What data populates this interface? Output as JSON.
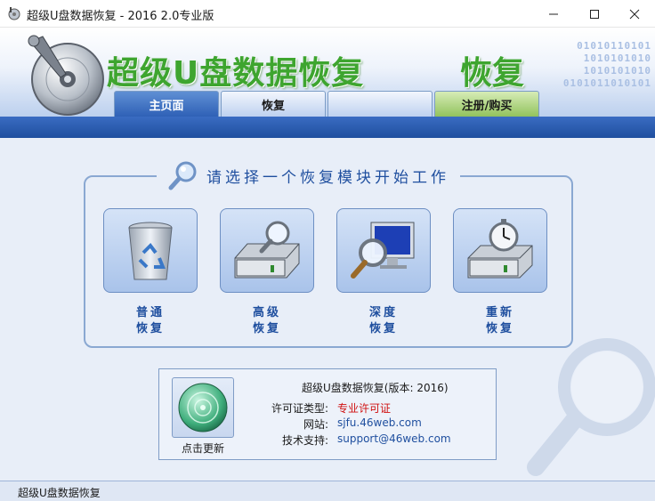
{
  "window": {
    "title": "超级U盘数据恢复 - 2016 2.0专业版"
  },
  "banner": {
    "brand_text": "超级U盘数据恢复",
    "brand_char": "恢复",
    "binary_lines": [
      "01010110101",
      "1010101010",
      "1010101010",
      "0101011010101"
    ]
  },
  "tabs": [
    {
      "label": "主页面",
      "active": true
    },
    {
      "label": "恢复"
    },
    {
      "label": ""
    },
    {
      "label": "注册/购买"
    }
  ],
  "modules": {
    "title": "请选择一个恢复模块开始工作",
    "items": [
      {
        "line1": "普通",
        "line2": "恢复",
        "icon": "recycle-bin-icon"
      },
      {
        "line1": "高级",
        "line2": "恢复",
        "icon": "drive-search-icon"
      },
      {
        "line1": "深度",
        "line2": "恢复",
        "icon": "monitor-search-icon"
      },
      {
        "line1": "重新",
        "line2": "恢复",
        "icon": "drive-stopwatch-icon"
      }
    ]
  },
  "info": {
    "update_label": "点击更新",
    "version_line": "超级U盘数据恢复(版本: 2016)",
    "rows": [
      {
        "key": "许可证类型:",
        "value": "专业许可证"
      },
      {
        "key": "网站:",
        "value": "sjfu.46web.com"
      },
      {
        "key": "技术支持:",
        "value": "support@46web.com"
      }
    ]
  },
  "statusbar": {
    "text": "超级U盘数据恢复"
  },
  "colors": {
    "accent_blue": "#1f4f9f",
    "brand_green": "#3ea52f",
    "license_red": "#d01010"
  }
}
